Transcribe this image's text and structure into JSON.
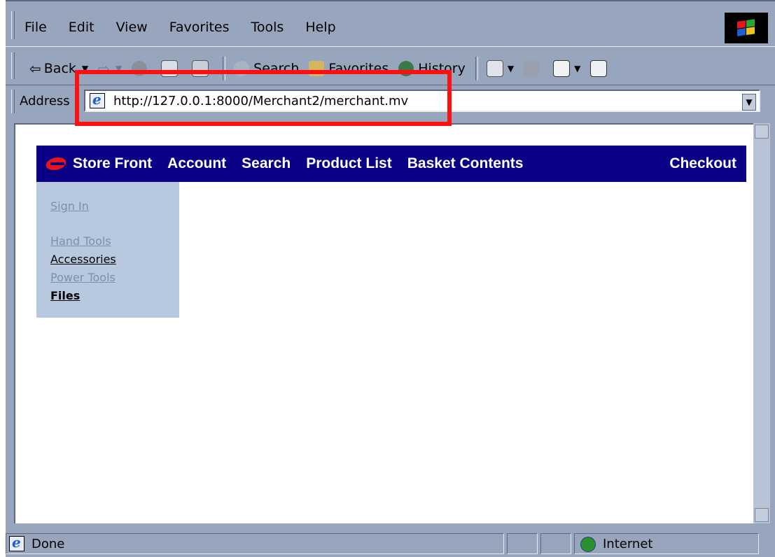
{
  "menu": {
    "items": [
      {
        "label": "File"
      },
      {
        "label": "Edit"
      },
      {
        "label": "View"
      },
      {
        "label": "Favorites"
      },
      {
        "label": "Tools"
      },
      {
        "label": "Help"
      }
    ]
  },
  "toolbar": {
    "back": "Back",
    "search": "Search",
    "favorites": "Favorites",
    "history": "History"
  },
  "address": {
    "label": "Address",
    "url": "http://127.0.0.1:8000/Merchant2/merchant.mv"
  },
  "store": {
    "nav": [
      "Store Front",
      "Account",
      "Search",
      "Product List",
      "Basket Contents",
      "Checkout"
    ],
    "sidebar": {
      "sign_in": "Sign In",
      "categories": [
        "Hand Tools",
        "Accessories",
        "Power Tools",
        "Files"
      ]
    }
  },
  "status": {
    "text": "Done",
    "zone": "Internet"
  },
  "colors": {
    "chrome": "#98a6bd",
    "nav_bg": "#0a0085",
    "sidebar_bg": "#b7c8df",
    "highlight": "#ff1010"
  }
}
